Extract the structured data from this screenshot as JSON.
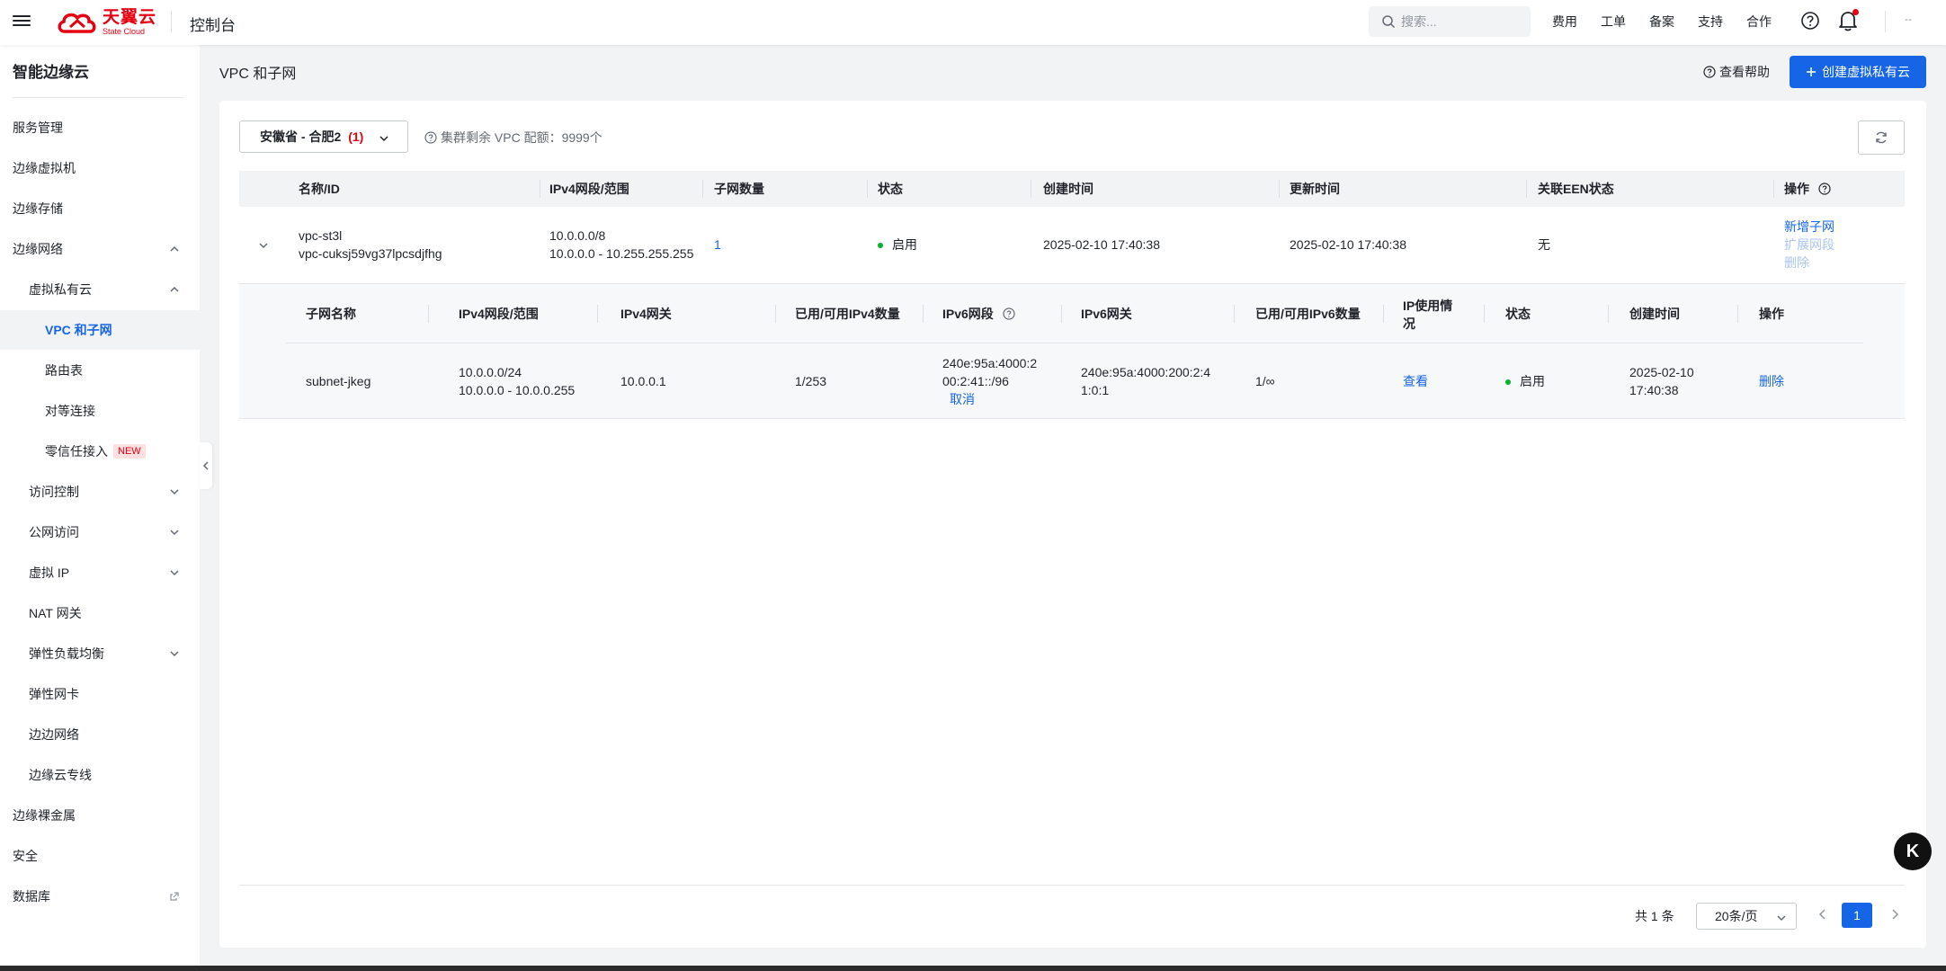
{
  "topbar": {
    "logo_cn": "天翼云",
    "logo_en": "State Cloud",
    "console": "控制台",
    "search_placeholder": "搜索...",
    "nav": [
      "费用",
      "工单",
      "备案",
      "支持",
      "合作"
    ],
    "user": "--"
  },
  "sidebar": {
    "title": "智能边缘云",
    "items": [
      {
        "label": "服务管理"
      },
      {
        "label": "边缘虚拟机"
      },
      {
        "label": "边缘存储"
      },
      {
        "label": "边缘网络"
      },
      {
        "label": "虚拟私有云"
      },
      {
        "label": "VPC 和子网"
      },
      {
        "label": "路由表"
      },
      {
        "label": "对等连接"
      },
      {
        "label": "零信任接入",
        "badge": "NEW"
      },
      {
        "label": "访问控制"
      },
      {
        "label": "公网访问"
      },
      {
        "label": "虚拟 IP"
      },
      {
        "label": "NAT 网关"
      },
      {
        "label": "弹性负载均衡"
      },
      {
        "label": "弹性网卡"
      },
      {
        "label": "边边网络"
      },
      {
        "label": "边缘云专线"
      },
      {
        "label": "边缘裸金属"
      },
      {
        "label": "安全"
      },
      {
        "label": "数据库"
      }
    ]
  },
  "page": {
    "title": "VPC 和子网",
    "help": "查看帮助",
    "create": "创建虚拟私有云"
  },
  "filter": {
    "region": "安徽省 - 合肥2",
    "region_count": "(1)",
    "quota": "集群剩余 VPC 配额：9999个"
  },
  "vpc_table": {
    "headers": [
      "名称/ID",
      "IPv4网段/范围",
      "子网数量",
      "状态",
      "创建时间",
      "更新时间",
      "关联EEN状态",
      "操作"
    ],
    "row": {
      "name": "vpc-st3l",
      "id": "vpc-cuksj59vg37lpcsdjfhg",
      "cidr": "10.0.0.0/8",
      "range": "10.0.0.0 - 10.255.255.255",
      "subnets": "1",
      "status": "启用",
      "created": "2025-02-10 17:40:38",
      "updated": "2025-02-10 17:40:38",
      "een": "无",
      "actions": [
        "新增子网",
        "扩展网段",
        "删除"
      ]
    }
  },
  "subnet_table": {
    "headers": [
      "子网名称",
      "IPv4网段/范围",
      "IPv4网关",
      "已用/可用IPv4数量",
      "IPv6网段",
      "IPv6网关",
      "已用/可用IPv6数量",
      "IP使用情况",
      "状态",
      "创建时间",
      "操作"
    ],
    "row": {
      "name": "subnet-jkeg",
      "cidr": "10.0.0.0/24",
      "range": "10.0.0.0 - 10.0.0.255",
      "gateway": "10.0.0.1",
      "ipv4_usage": "1/253",
      "ipv6_seg_1": "240e:95a:4000:2",
      "ipv6_seg_2": "00:2:41::/96",
      "ipv6_cancel": "取消",
      "ipv6_gw_1": "240e:95a:4000:200:2:4",
      "ipv6_gw_2": "1:0:1",
      "ipv6_usage": "1/∞",
      "ip_view": "查看",
      "status": "启用",
      "created_1": "2025-02-10",
      "created_2": "17:40:38",
      "action": "删除"
    }
  },
  "pagination": {
    "total": "共 1 条",
    "page_size": "20条/页",
    "current": "1"
  },
  "float_button": "K"
}
